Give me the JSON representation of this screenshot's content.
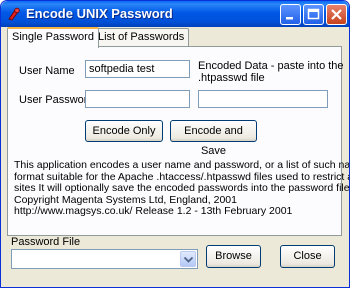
{
  "window": {
    "title": "Encode UNIX Password"
  },
  "tabs": [
    {
      "label": "Single Password",
      "active": true
    },
    {
      "label": "List of Passwords",
      "active": false
    }
  ],
  "form": {
    "user_name_label": "User Name",
    "user_name_value": "softpedia test",
    "user_password_label": "User Password",
    "user_password_value": "",
    "encoded_label_line1": "Encoded Data - paste into the",
    "encoded_label_line2": ".htpasswd file",
    "encoded_value_top": "",
    "encoded_value_bottom": ""
  },
  "buttons": {
    "encode_only": "Encode Only",
    "encode_and_save": "Encode and Save",
    "browse": "Browse",
    "close": "Close"
  },
  "description": [
    "This application encodes a user name and password, or a list of such names, into UNIX",
    "format suitable for the Apache .htaccess/.htpasswd files used to restrict access to web",
    "sites It will optionally save the encoded passwords into the password file as well",
    "Copyright Magenta Systems Ltd, England, 2001",
    "http://www.magsys.co.uk/    Release 1.2 - 13th February 2001"
  ],
  "password_file": {
    "label": "Password File",
    "value": ""
  },
  "colors": {
    "titlebar": "#0058e6",
    "window_bg": "#ece9d8",
    "close_button": "#c8421e"
  }
}
